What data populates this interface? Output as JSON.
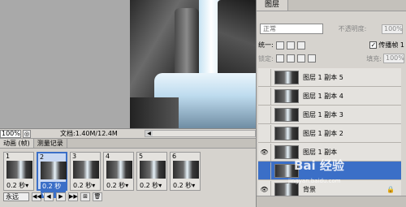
{
  "status": {
    "zoom": "100%",
    "doc_info": "文档:1.40M/12.4M",
    "arrow": "▶"
  },
  "animation": {
    "tabs": [
      "动画 (帧)",
      "测量记录"
    ],
    "frames": [
      {
        "num": "1",
        "delay": "0.2 秒▾"
      },
      {
        "num": "2",
        "delay": "0.2 秒▾"
      },
      {
        "num": "3",
        "delay": "0.2 秒▾"
      },
      {
        "num": "4",
        "delay": "0.2 秒▾"
      },
      {
        "num": "5",
        "delay": "0.2 秒▾"
      },
      {
        "num": "6",
        "delay": "0.2 秒▾"
      }
    ],
    "loop": "永远",
    "controls": [
      "◀◀",
      "◀",
      "▶",
      "▶▶",
      "⊞",
      "🗑"
    ]
  },
  "layers_panel": {
    "tab": "图层",
    "blend_mode": "正常",
    "opacity_label": "不透明度:",
    "opacity_value": "100%",
    "unify_label": "统一:",
    "propagate_label": "传播帧 1",
    "lock_label": "锁定:",
    "fill_label": "填充:",
    "fill_value": "100%",
    "layers": [
      {
        "name": "图层 1 副本 5",
        "visible": false
      },
      {
        "name": "图层 1 副本 4",
        "visible": false
      },
      {
        "name": "图层 1 副本 3",
        "visible": false
      },
      {
        "name": "图层 1 副本 2",
        "visible": false
      },
      {
        "name": "图层 1 副本",
        "visible": true
      },
      {
        "name": "",
        "visible": false
      },
      {
        "name": "背景",
        "visible": true
      }
    ]
  },
  "watermark": {
    "text": "Bai 经验",
    "sub": "jingyan.baidu.com"
  }
}
